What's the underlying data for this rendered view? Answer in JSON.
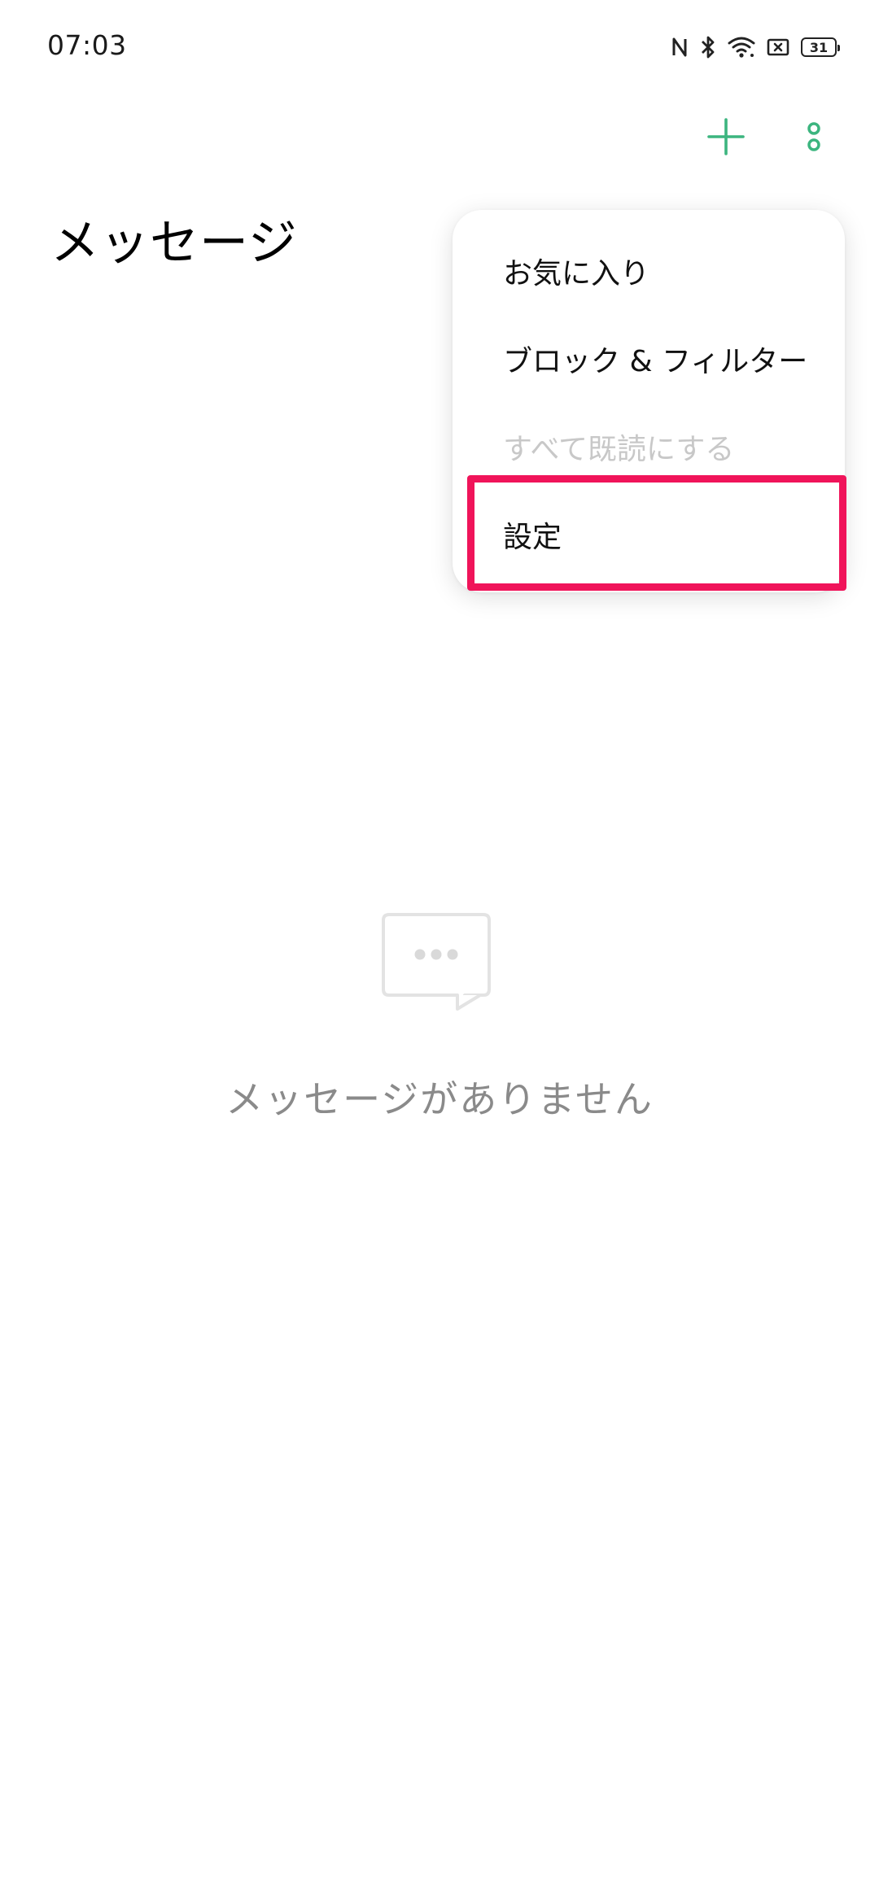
{
  "status_bar": {
    "time": "07:03",
    "battery_level": "31",
    "icons": [
      "nfc-icon",
      "bluetooth-icon",
      "wifi-icon",
      "screen-cast-icon",
      "battery-icon"
    ]
  },
  "toolbar": {
    "add_icon": "plus-icon",
    "more_icon": "more-vertical-icon",
    "accent_color": "#3cb57f"
  },
  "page": {
    "title": "メッセージ"
  },
  "menu": {
    "items": [
      {
        "label": "お気に入り",
        "enabled": true
      },
      {
        "label": "ブロック & フィルター",
        "enabled": true
      },
      {
        "label": "すべて既読にする",
        "enabled": false
      },
      {
        "label": "設定",
        "enabled": true,
        "highlighted": true
      }
    ],
    "highlight_color": "#f0145a"
  },
  "empty_state": {
    "icon": "chat-bubble-icon",
    "message": "メッセージがありません"
  }
}
